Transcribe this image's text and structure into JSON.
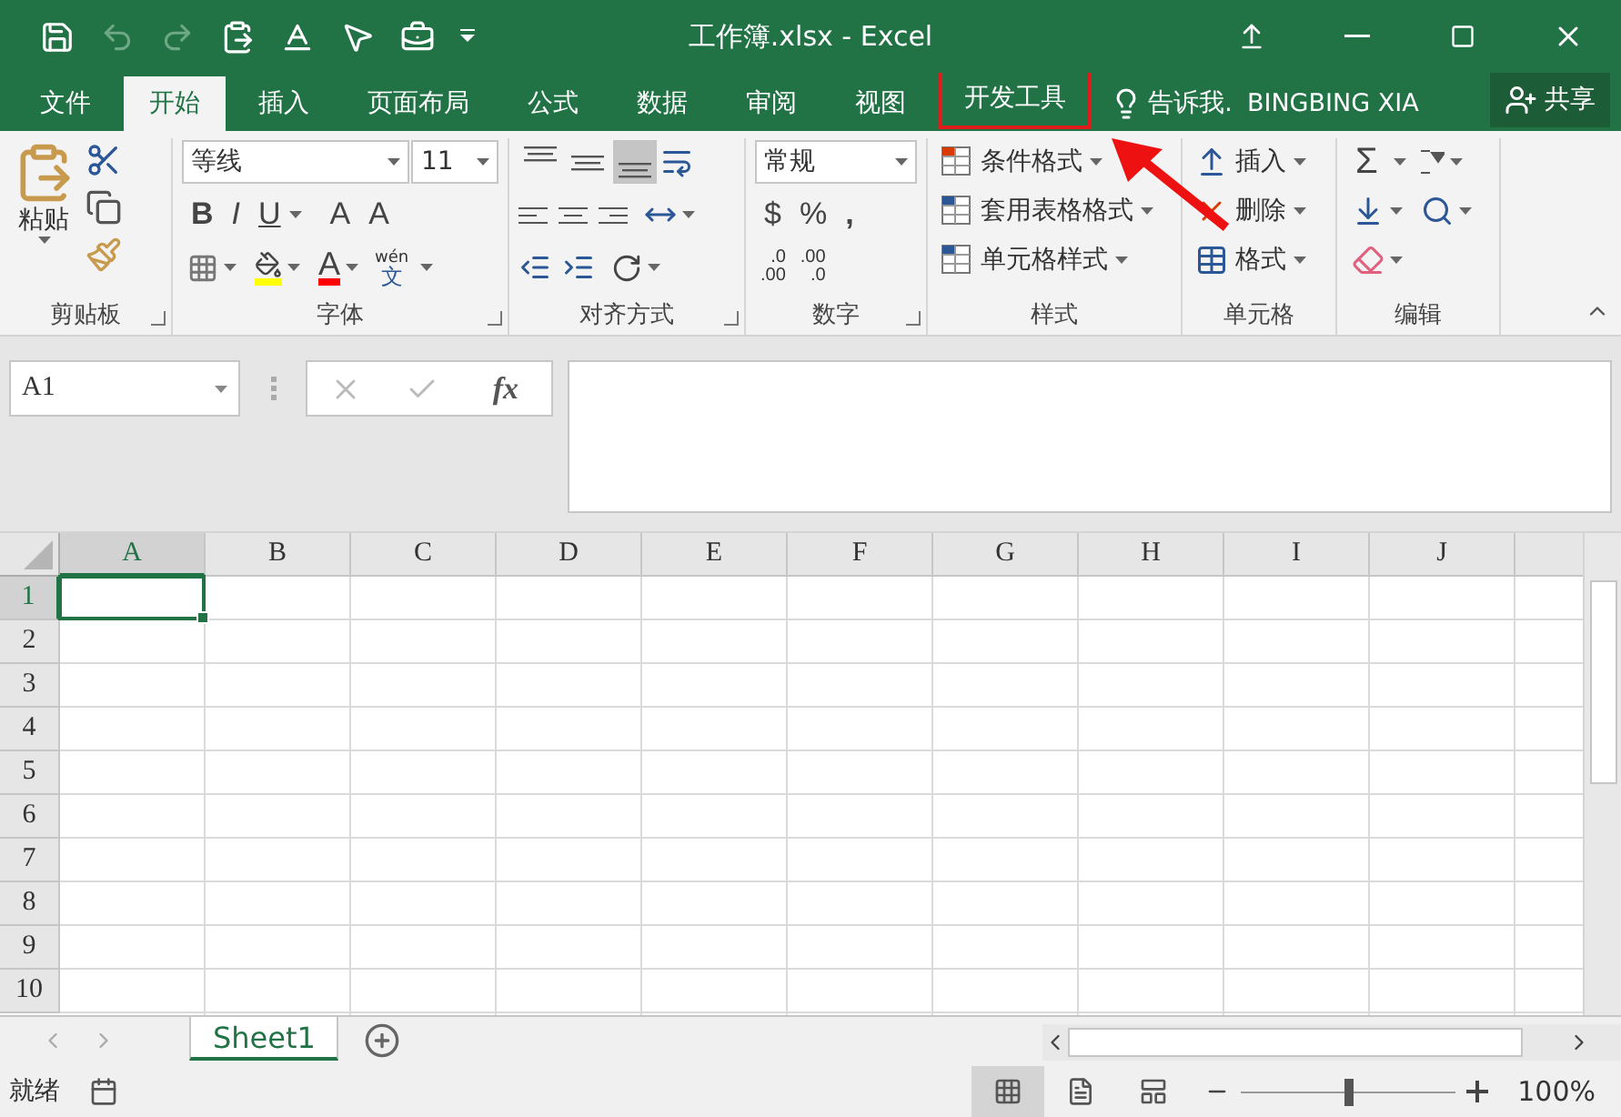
{
  "window": {
    "title": "工作簿.xlsx - Excel"
  },
  "quick_access": [
    {
      "kind": "save",
      "disabled": false
    },
    {
      "kind": "undo",
      "disabled": true
    },
    {
      "kind": "redo",
      "disabled": true
    },
    {
      "kind": "paste",
      "disabled": false
    },
    {
      "kind": "font",
      "disabled": false
    },
    {
      "kind": "pointer",
      "disabled": false
    },
    {
      "kind": "toolbox",
      "disabled": false
    },
    {
      "kind": "customize",
      "disabled": false
    }
  ],
  "tabs": [
    {
      "label": "文件",
      "selected": false,
      "highlighted": false
    },
    {
      "label": "开始",
      "selected": true,
      "highlighted": false
    },
    {
      "label": "插入",
      "selected": false,
      "highlighted": false
    },
    {
      "label": "页面布局",
      "selected": false,
      "highlighted": false
    },
    {
      "label": "公式",
      "selected": false,
      "highlighted": false
    },
    {
      "label": "数据",
      "selected": false,
      "highlighted": false
    },
    {
      "label": "审阅",
      "selected": false,
      "highlighted": false
    },
    {
      "label": "视图",
      "selected": false,
      "highlighted": false
    },
    {
      "label": "开发工具",
      "selected": false,
      "highlighted": true
    }
  ],
  "tell_me": "告诉我.",
  "user": "BINGBING XIA",
  "share": "共享",
  "ribbon": {
    "clipboard": {
      "label": "剪贴板",
      "paste": "粘贴",
      "launcher": true
    },
    "font": {
      "label": "字体",
      "font_name": "等线",
      "font_size": "11",
      "style_buttons": [
        "B",
        "I",
        "U"
      ],
      "grow": "A",
      "shrink": "A",
      "font_color": "A",
      "phonetic_top": "wén",
      "phonetic_bottom": "文",
      "launcher": true
    },
    "alignment": {
      "label": "对齐方式",
      "vertical_align": [
        {
          "kind": "top",
          "selected": false
        },
        {
          "kind": "middle",
          "selected": false
        },
        {
          "kind": "bottom",
          "selected": true
        }
      ],
      "launcher": true
    },
    "number": {
      "label": "数字",
      "format": "常规",
      "symbols": [
        "$",
        "%",
        ","
      ],
      "decimal_buttons": [
        {
          "top": ".0",
          "bottom": ".00"
        },
        {
          "top": ".00",
          "bottom": ".0"
        }
      ],
      "launcher": true
    },
    "styles": {
      "label": "样式",
      "items": [
        {
          "kind": "conditional",
          "label": "条件格式"
        },
        {
          "kind": "table",
          "label": "套用表格格式"
        },
        {
          "kind": "cell",
          "label": "单元格样式"
        }
      ]
    },
    "cells": {
      "label": "单元格",
      "items": [
        {
          "kind": "insert",
          "label": "插入"
        },
        {
          "kind": "delete",
          "label": "删除"
        },
        {
          "kind": "format",
          "label": "格式"
        }
      ]
    },
    "editing": {
      "label": "编辑",
      "sum": "Σ"
    }
  },
  "formula_bar": {
    "name_box": "A1",
    "fx": "fx"
  },
  "columns": [
    {
      "label": "A",
      "selected": true
    },
    {
      "label": "B",
      "selected": false
    },
    {
      "label": "C",
      "selected": false
    },
    {
      "label": "D",
      "selected": false
    },
    {
      "label": "E",
      "selected": false
    },
    {
      "label": "F",
      "selected": false
    },
    {
      "label": "G",
      "selected": false
    },
    {
      "label": "H",
      "selected": false
    },
    {
      "label": "I",
      "selected": false
    },
    {
      "label": "J",
      "selected": false
    }
  ],
  "rows": [
    {
      "label": "1",
      "selected": true
    },
    {
      "label": "2",
      "selected": false
    },
    {
      "label": "3",
      "selected": false
    },
    {
      "label": "4",
      "selected": false
    },
    {
      "label": "5",
      "selected": false
    },
    {
      "label": "6",
      "selected": false
    },
    {
      "label": "7",
      "selected": false
    },
    {
      "label": "8",
      "selected": false
    },
    {
      "label": "9",
      "selected": false
    },
    {
      "label": "10",
      "selected": false
    }
  ],
  "sheets": [
    {
      "label": "Sheet1",
      "selected": true
    }
  ],
  "status_bar": {
    "status": "就绪",
    "views": [
      {
        "kind": "normal",
        "selected": true
      },
      {
        "kind": "page_layout",
        "selected": false
      },
      {
        "kind": "page_break",
        "selected": false
      }
    ],
    "zoom": {
      "level": 0.5
    },
    "zoom_text": "100%"
  }
}
